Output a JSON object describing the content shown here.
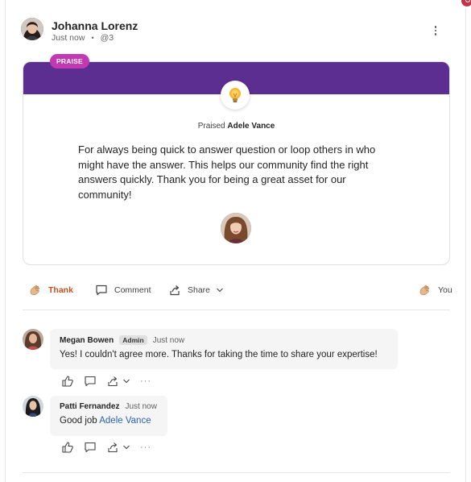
{
  "post": {
    "author": "Johanna Lorenz",
    "time": "Just now",
    "separator": "•",
    "group": "@3"
  },
  "praise": {
    "tag": "PRAISE",
    "praised_prefix": "Praised",
    "recipient": "Adele Vance",
    "message": "For always being quick to answer question or loop others in who might have the answer. This helps our community find the right answers quickly. Thank you for being a great asset for our community!",
    "badge_icon": "lightbulb-icon"
  },
  "actions": {
    "thank": "Thank",
    "comment": "Comment",
    "share": "Share",
    "you": "You"
  },
  "comments": [
    {
      "name": "Megan Bowen",
      "role": "Admin",
      "time": "Just now",
      "text": "Yes! I couldn't agree more. Thanks for taking the time to share your expertise!"
    },
    {
      "name": "Patti Fernandez",
      "time": "Just now",
      "text_prefix": "Good job ",
      "mention": "Adele Vance"
    }
  ],
  "comment_actions": {
    "more": "···"
  },
  "colors": {
    "banner": "#5c2e91",
    "praise_tag": "#c239b3",
    "thank": "#c4511a",
    "mention": "#2b62b0"
  }
}
